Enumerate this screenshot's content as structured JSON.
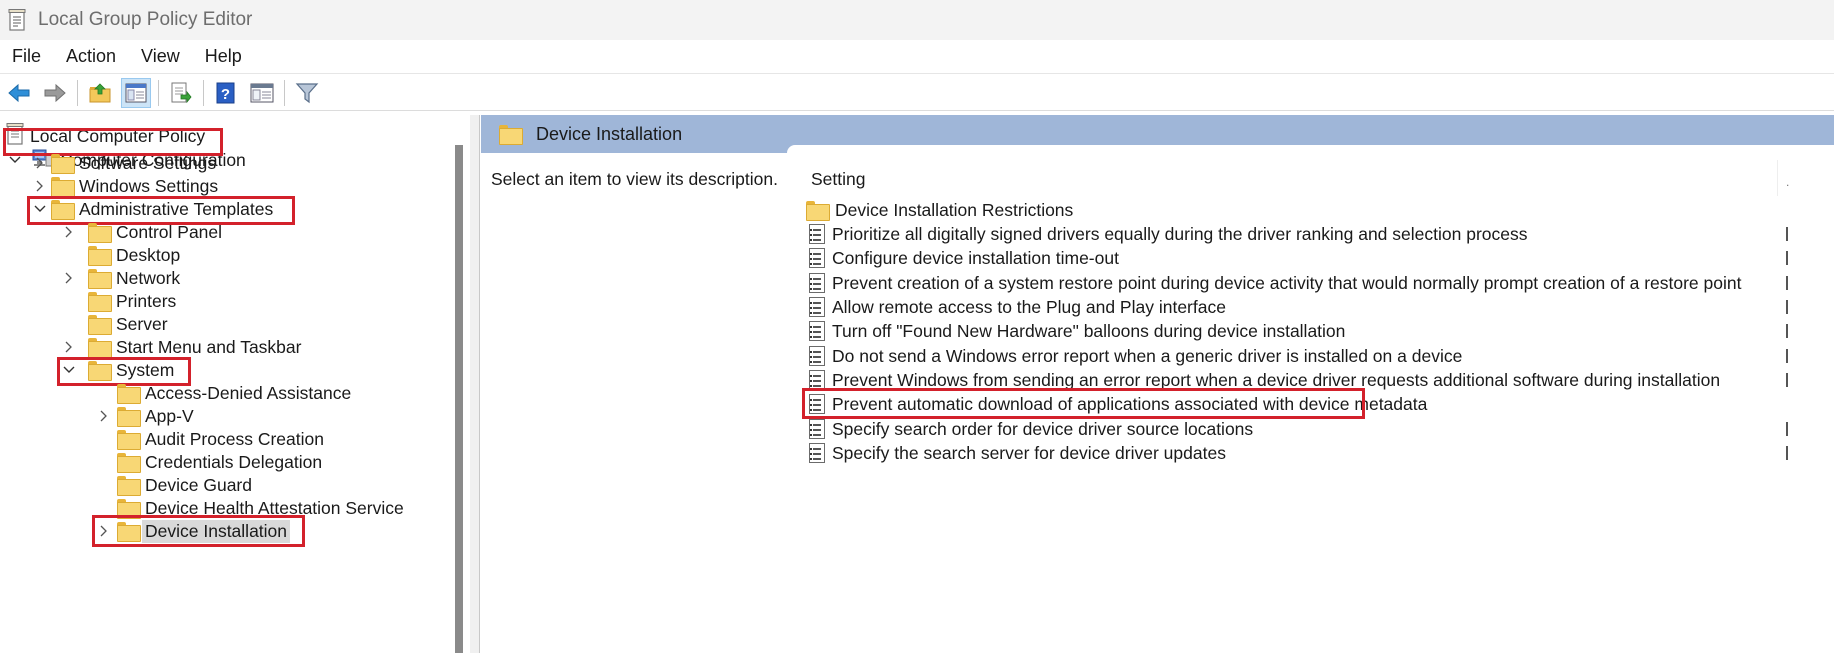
{
  "window": {
    "title": "Local Group Policy Editor"
  },
  "menu": [
    "File",
    "Action",
    "View",
    "Help"
  ],
  "toolbar": {
    "buttons": [
      "back-arrow-icon",
      "forward-arrow-icon",
      "up-folder-icon",
      "show-hide-tree-icon",
      "export-list-icon",
      "help-icon",
      "extended-view-icon",
      "filter-icon"
    ]
  },
  "tree": {
    "root": "Local Computer Policy",
    "computer_configuration": "Computer Configuration",
    "software_settings": "Software Settings",
    "windows_settings": "Windows Settings",
    "administrative_templates": "Administrative Templates",
    "control_panel": "Control Panel",
    "desktop": "Desktop",
    "network": "Network",
    "printers": "Printers",
    "server": "Server",
    "start_menu": "Start Menu and Taskbar",
    "system": "System",
    "access_denied": "Access-Denied Assistance",
    "app_v": "App-V",
    "audit_process": "Audit Process Creation",
    "credentials_delegation": "Credentials Delegation",
    "device_guard": "Device Guard",
    "device_health": "Device Health Attestation Service",
    "device_installation": "Device Installation"
  },
  "details": {
    "header_title": "Device Installation",
    "description": "Select an item to view its description.",
    "column_setting": "Setting",
    "settings": [
      {
        "label": "Device Installation Restrictions",
        "kind": "folder"
      },
      {
        "label": "Prioritize all digitally signed drivers equally during the driver ranking and selection process",
        "kind": "policy"
      },
      {
        "label": "Configure device installation time-out",
        "kind": "policy"
      },
      {
        "label": "Prevent creation of a system restore point during device activity that would normally prompt creation of a restore point",
        "kind": "policy"
      },
      {
        "label": "Allow remote access to the Plug and Play interface",
        "kind": "policy"
      },
      {
        "label": "Turn off \"Found New Hardware\" balloons during device installation",
        "kind": "policy"
      },
      {
        "label": "Do not send a Windows error report when a generic driver is installed on a device",
        "kind": "policy"
      },
      {
        "label": "Prevent Windows from sending an error report when a device driver requests additional software during installation",
        "kind": "policy"
      },
      {
        "label": "Prevent automatic download of applications associated with device metadata",
        "kind": "policy"
      },
      {
        "label": "Specify search order for device driver source locations",
        "kind": "policy"
      },
      {
        "label": "Specify the search server for device driver updates",
        "kind": "policy"
      }
    ]
  },
  "colors": {
    "highlight": "#d3212b",
    "header_band": "#9fb6d8",
    "folder": "#f8d775"
  }
}
